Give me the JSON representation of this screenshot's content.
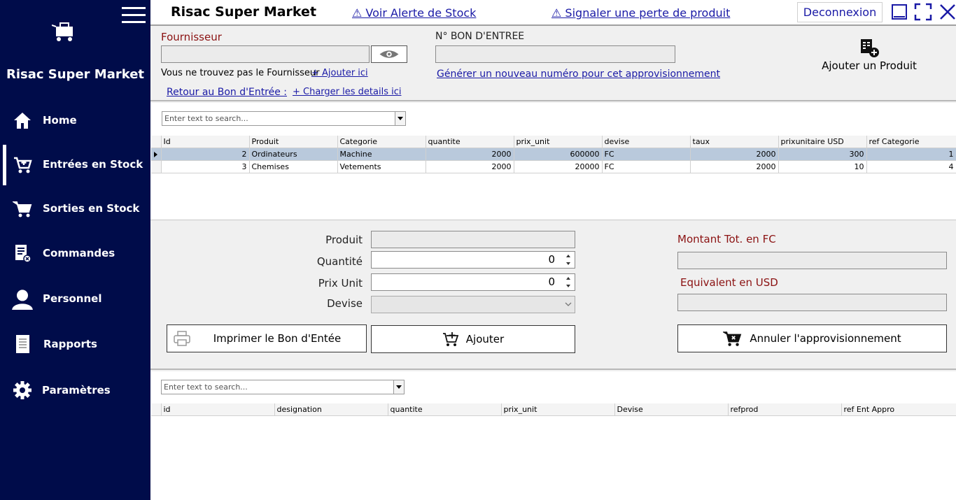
{
  "sidebar": {
    "brand": "Risac Super Market",
    "items": [
      {
        "label": "Home",
        "icon": "home-icon"
      },
      {
        "label": "Entrées en Stock",
        "icon": "cart-add-icon"
      },
      {
        "label": "Sorties en Stock",
        "icon": "cart-out-icon"
      },
      {
        "label": "Commandes",
        "icon": "order-list-icon"
      },
      {
        "label": "Personnel",
        "icon": "user-icon"
      },
      {
        "label": "Rapports",
        "icon": "report-icon"
      },
      {
        "label": "Paramètres",
        "icon": "gear-icon"
      }
    ]
  },
  "topbar": {
    "title": "Risac Super Market",
    "stock_alert": "⚠ Voir Alerte de Stock",
    "report_loss": "⚠ Signaler une perte de produit",
    "logout": "Deconnexion"
  },
  "form_top": {
    "fournisseur_label": "Fournisseur",
    "bon_label": "N° BON D'ENTREE",
    "not_found_text": "Vous ne trouvez pas le Fournisseur",
    "add_here": "+ Ajouter ici",
    "generate_link": "Générer un nouveau numéro pour cet approvisionnement",
    "back_link": "Retour au Bon d'Entrée  :",
    "load_details": "+ Charger les details ici",
    "add_product": "Ajouter un Produit"
  },
  "grid1": {
    "search_placeholder": "Enter text to search...",
    "columns": [
      "Id",
      "Produit",
      "Categorie",
      "quantite",
      "prix_unit",
      "devise",
      "taux",
      "prixunitaire USD",
      "ref Categorie"
    ],
    "rows": [
      [
        "2",
        "Ordinateurs",
        "Machine",
        "2000",
        "600000",
        "FC",
        "2000",
        "300",
        "1"
      ],
      [
        "3",
        "Chemises",
        "Vetements",
        "2000",
        "20000",
        "FC",
        "2000",
        "10",
        "4"
      ]
    ]
  },
  "middle": {
    "produit_label": "Produit",
    "quantite_label": "Quantité",
    "quantite_value": "0",
    "prix_label": "Prix Unit",
    "prix_value": "0",
    "devise_label": "Devise",
    "montant_label": "Montant Tot. en FC",
    "equiv_label": "Equivalent en USD",
    "print_button": "Imprimer le Bon d'Entée",
    "add_button": "Ajouter",
    "cancel_button": "Annuler l'approvisionnement"
  },
  "grid2": {
    "search_placeholder": "Enter text to search...",
    "columns": [
      "id",
      "designation",
      "quantite",
      "prix_unit",
      "Devise",
      "refprod",
      "ref Ent Appro"
    ]
  },
  "colors": {
    "sidebar_bg": "#000c4a",
    "link": "#1a1aa6",
    "label_red": "#8b1212",
    "selected_row": "#b9c9dc"
  }
}
